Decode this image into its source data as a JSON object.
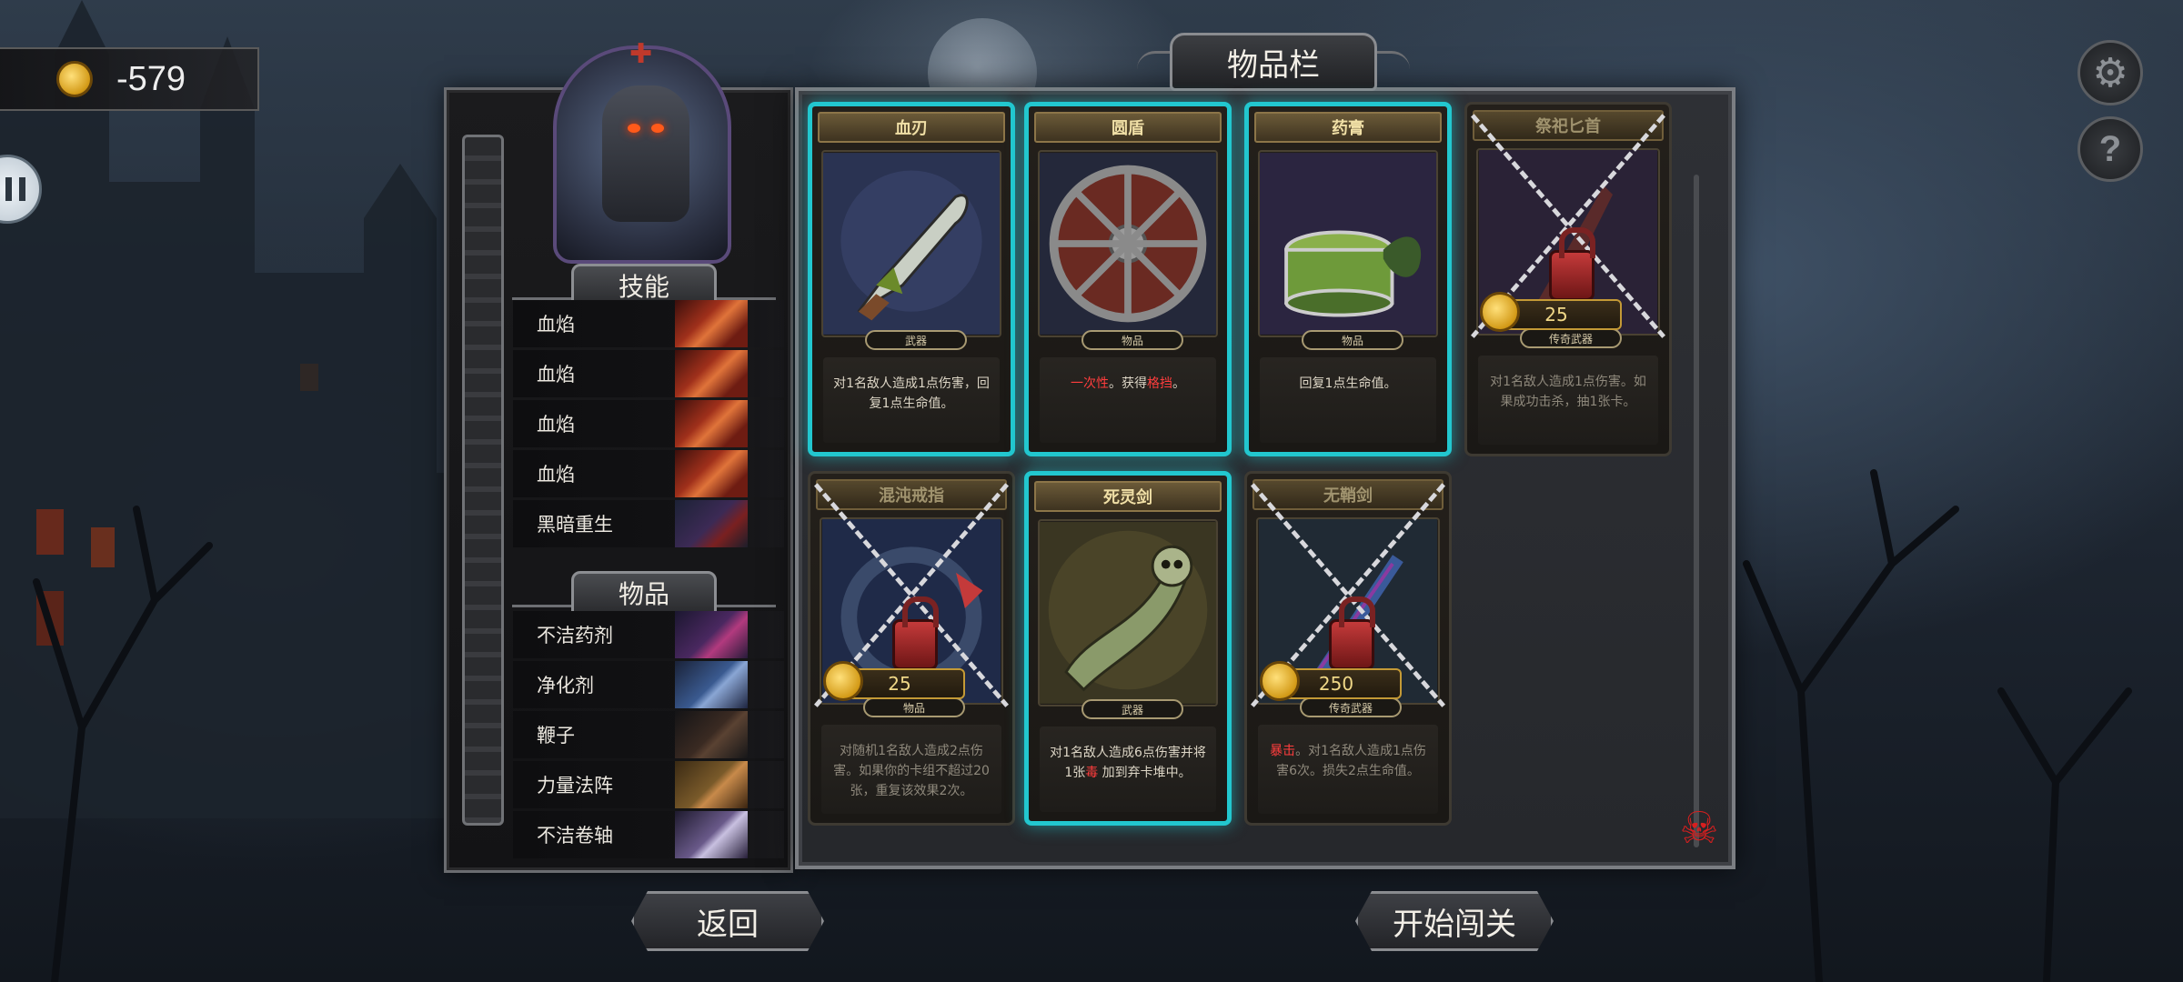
{
  "gold": {
    "value": "-579"
  },
  "skills_header": "技能",
  "items_header": "物品",
  "skills": [
    {
      "label": "血焰",
      "thumb": "flame"
    },
    {
      "label": "血焰",
      "thumb": "flame"
    },
    {
      "label": "血焰",
      "thumb": "flame"
    },
    {
      "label": "血焰",
      "thumb": "flame"
    },
    {
      "label": "黑暗重生",
      "thumb": "dark"
    }
  ],
  "items": [
    {
      "label": "不洁药剂",
      "thumb": "potion"
    },
    {
      "label": "净化剂",
      "thumb": "blue"
    },
    {
      "label": "鞭子",
      "thumb": "whip"
    },
    {
      "label": "力量法阵",
      "thumb": "circle"
    },
    {
      "label": "不洁卷轴",
      "thumb": "scroll"
    }
  ],
  "inventory_title": "物品栏",
  "cards": [
    {
      "title": "血刃",
      "type": "武器",
      "desc": "对1名敌人造成1点伤害，回复1点生命值。",
      "selected": true,
      "locked": false,
      "art": "blade"
    },
    {
      "title": "圆盾",
      "type": "物品",
      "desc_parts": [
        "一次性",
        "。获得",
        "格挡",
        "。"
      ],
      "selected": true,
      "locked": false,
      "art": "shield"
    },
    {
      "title": "药膏",
      "type": "物品",
      "desc": "回复1点生命值。",
      "selected": true,
      "locked": false,
      "art": "salve"
    },
    {
      "title": "祭祀匕首",
      "type": "传奇武器",
      "desc": "对1名敌人造成1点伤害。如果成功击杀，抽1张卡。",
      "selected": false,
      "locked": true,
      "price": "25",
      "art": "dagger"
    },
    {
      "title": "混沌戒指",
      "type": "物品",
      "desc": "对随机1名敌人造成2点伤害。如果你的卡组不超过20张，重复该效果2次。",
      "selected": false,
      "locked": true,
      "price": "25",
      "art": "ring"
    },
    {
      "title": "死灵剑",
      "type": "武器",
      "desc_parts": [
        "对1名敌人造成6点伤害并将1张",
        "毒",
        " 加到弃卡堆中。"
      ],
      "selected": true,
      "locked": false,
      "art": "necro"
    },
    {
      "title": "无鞘剑",
      "type": "传奇武器",
      "desc_parts": [
        "暴击",
        "。对1名敌人造成1点伤害6次。损失2点生命值。"
      ],
      "selected": false,
      "locked": true,
      "price": "250",
      "art": "sword"
    }
  ],
  "buttons": {
    "back": "返回",
    "start": "开始闯关"
  },
  "colors": {
    "selected_border": "#22c7cf",
    "keyword_red": "#ff3d3d",
    "gold": "#d39a17"
  }
}
